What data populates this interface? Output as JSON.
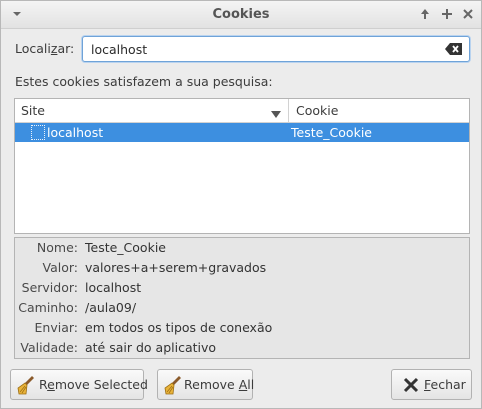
{
  "window": {
    "title": "Cookies"
  },
  "search": {
    "label_prefix": "Locali",
    "label_mnemonic": "z",
    "label_suffix": "ar:",
    "value": "localhost",
    "clear_icon": "clear-backspace-icon"
  },
  "results_label": "Estes cookies satisfazem a sua pesquisa:",
  "tree": {
    "columns": [
      "Site",
      "Cookie"
    ],
    "rows": [
      {
        "site": "localhost",
        "cookie": "Teste_Cookie",
        "selected": true
      }
    ]
  },
  "details": {
    "name_label": "Nome:",
    "name_value": "Teste_Cookie",
    "value_label": "Valor:",
    "value_value": "valores+a+serem+gravados",
    "server_label": "Servidor:",
    "server_value": "localhost",
    "path_label": "Caminho:",
    "path_value": "/aula09/",
    "send_label": "Enviar:",
    "send_value": "em todos os tipos de conexão",
    "expiry_label": "Validade:",
    "expiry_value": "até sair do aplicativo"
  },
  "buttons": {
    "remove_selected_prefix": "R",
    "remove_selected_mnemonic": "e",
    "remove_selected_suffix": "move Selected",
    "remove_all_prefix": "Remove ",
    "remove_all_mnemonic": "A",
    "remove_all_suffix": "ll",
    "close_mnemonic": "F",
    "close_suffix": "echar"
  },
  "colors": {
    "selection": "#3d8fe0",
    "focus_border": "#6fa3d8"
  }
}
